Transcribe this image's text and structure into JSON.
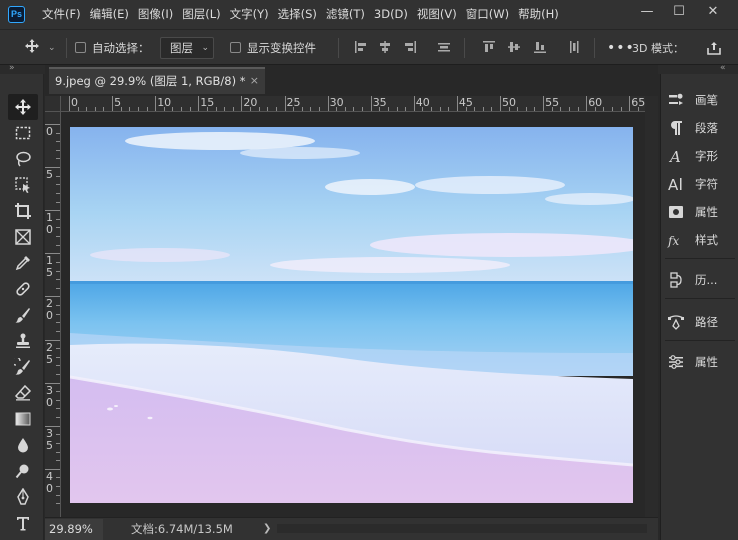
{
  "app": {
    "logo": "Ps"
  },
  "menu": [
    "文件(F)",
    "编辑(E)",
    "图像(I)",
    "图层(L)",
    "文字(Y)",
    "选择(S)",
    "滤镜(T)",
    "3D(D)",
    "视图(V)",
    "窗口(W)",
    "帮助(H)"
  ],
  "window_controls": {
    "minimize": "—",
    "maximize": "☐",
    "close": "✕"
  },
  "options": {
    "auto_select_label": "自动选择：",
    "auto_select_value": "图层",
    "show_transform_label": "显示变换控件",
    "mode_3d_label": "3D 模式："
  },
  "document": {
    "tab_title": "9.jpeg @ 29.9% (图层 1, RGB/8) *",
    "tab_close": "×",
    "zoom": "29.89%",
    "info": "文档:6.74M/13.5M",
    "info_menu": "❯"
  },
  "ruler": {
    "h_labels": [
      "0",
      "5",
      "10",
      "15",
      "20",
      "25",
      "30",
      "35",
      "40",
      "45",
      "50",
      "55",
      "60",
      "65"
    ],
    "v_labels": [
      "0",
      "5",
      "1\n0",
      "1\n5",
      "2\n0",
      "2\n5",
      "3\n0",
      "3\n5",
      "4\n0"
    ]
  },
  "tools": [
    {
      "name": "move-tool",
      "icon": "move-icon"
    },
    {
      "name": "marquee-tool",
      "icon": "rect-marquee-icon"
    },
    {
      "name": "lasso-tool",
      "icon": "lasso-icon"
    },
    {
      "name": "object-select-tool",
      "icon": "object-select-icon"
    },
    {
      "name": "crop-tool",
      "icon": "crop-icon"
    },
    {
      "name": "frame-tool",
      "icon": "frame-icon"
    },
    {
      "name": "eyedropper-tool",
      "icon": "eyedropper-icon"
    },
    {
      "name": "healing-tool",
      "icon": "bandage-icon"
    },
    {
      "name": "brush-tool",
      "icon": "brush-icon"
    },
    {
      "name": "stamp-tool",
      "icon": "stamp-icon"
    },
    {
      "name": "history-brush-tool",
      "icon": "history-brush-icon"
    },
    {
      "name": "eraser-tool",
      "icon": "eraser-icon"
    },
    {
      "name": "gradient-tool",
      "icon": "gradient-icon"
    },
    {
      "name": "blur-tool",
      "icon": "drop-icon"
    },
    {
      "name": "dodge-tool",
      "icon": "dodge-icon"
    },
    {
      "name": "pen-tool",
      "icon": "pen-icon"
    },
    {
      "name": "type-tool",
      "icon": "type-icon"
    }
  ],
  "panels": [
    {
      "label": "画笔",
      "icon": "brush-settings-icon"
    },
    {
      "label": "段落",
      "icon": "paragraph-icon"
    },
    {
      "label": "字形",
      "icon": "glyphs-icon"
    },
    {
      "label": "字符",
      "icon": "character-icon"
    },
    {
      "label": "属性",
      "icon": "properties-icon"
    },
    {
      "label": "样式",
      "icon": "styles-icon"
    },
    {
      "label": "历...",
      "icon": "history-icon"
    },
    {
      "label": "路径",
      "icon": "paths-icon"
    },
    {
      "label": "属性",
      "icon": "adjust-properties-icon"
    }
  ],
  "colors": {
    "accent": "#31a8ff",
    "chrome": "#323232",
    "canvas_bg": "#282828"
  }
}
